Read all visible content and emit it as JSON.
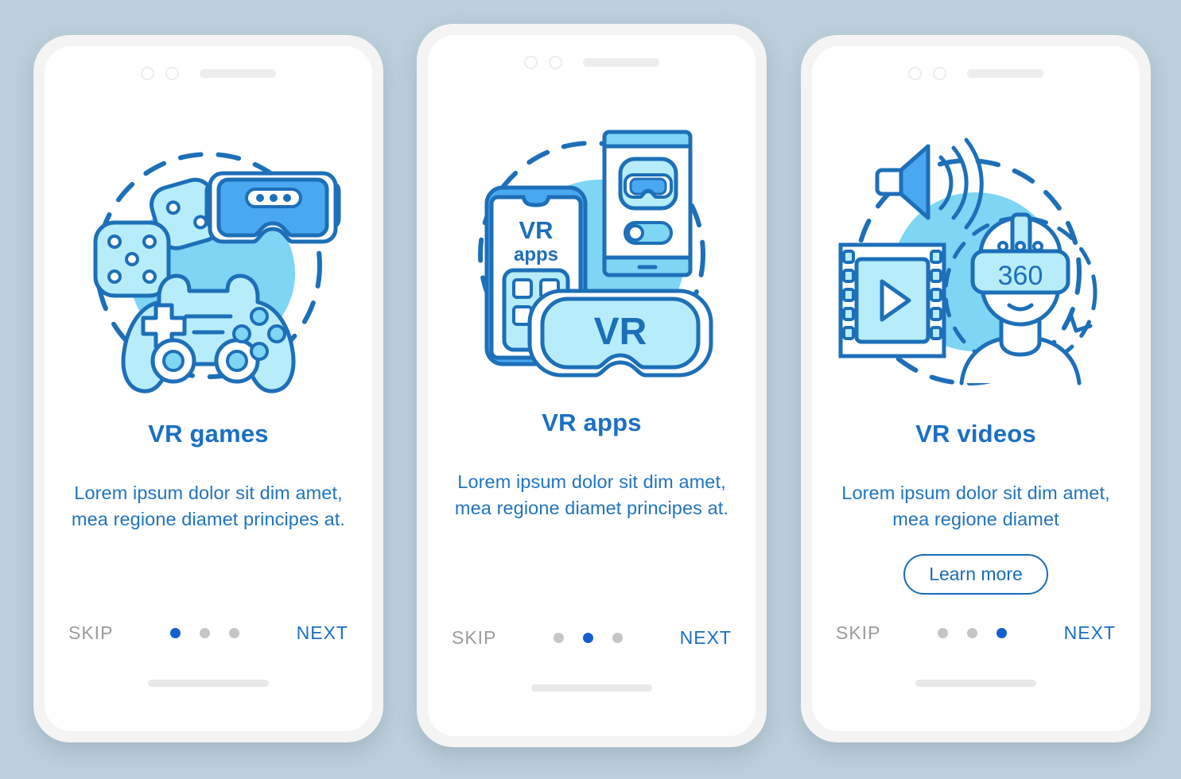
{
  "theme": {
    "background": "#bcd0dc",
    "phone_shell": "#f4f4f4",
    "screen": "#ffffff",
    "title_blue": "#1a6fc4",
    "body_blue": "#2074bf",
    "skip_gray": "#9b9b9b",
    "dot_active": "#1260cf",
    "dot_inactive": "#c6c6c6",
    "illus_circle": "#7ed5f4",
    "illus_light": "#b7ecfa",
    "illus_stroke": "#1d6fb8",
    "illus_accent": "#4aa8f0"
  },
  "screens": [
    {
      "id": "vr-games",
      "title": "VR games",
      "description": "Lorem ipsum dolor sit dim amet, mea regione diamet principes at.",
      "illustration": "vr-games-illustration",
      "has_learn_more": false,
      "learn_more_label": "",
      "skip_label": "SKIP",
      "next_label": "NEXT",
      "dots": 3,
      "active_dot": 0
    },
    {
      "id": "vr-apps",
      "title": "VR apps",
      "description": "Lorem ipsum dolor sit dim amet, mea regione diamet principes at.",
      "illustration": "vr-apps-illustration",
      "has_learn_more": false,
      "learn_more_label": "",
      "skip_label": "SKIP",
      "next_label": "NEXT",
      "dots": 3,
      "active_dot": 1
    },
    {
      "id": "vr-videos",
      "title": "VR videos",
      "description": "Lorem ipsum dolor sit dim amet, mea regione diamet",
      "illustration": "vr-videos-illustration",
      "has_learn_more": true,
      "learn_more_label": "Learn more",
      "skip_label": "SKIP",
      "next_label": "NEXT",
      "dots": 3,
      "active_dot": 2
    }
  ],
  "illustration_labels": {
    "vr_apps_phone_text_line1": "VR",
    "vr_apps_phone_text_line2": "apps",
    "vr_apps_goggles_text": "VR",
    "vr_videos_headset_text": "360"
  }
}
